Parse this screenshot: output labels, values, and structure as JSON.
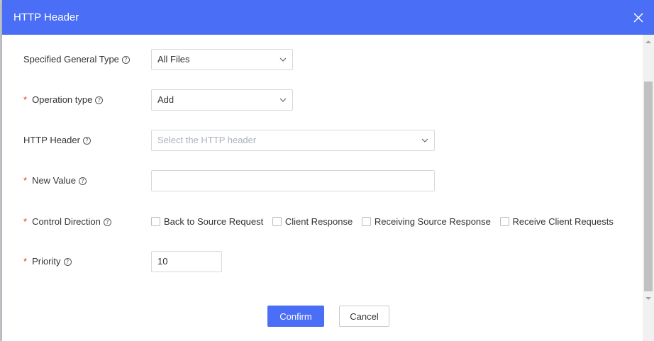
{
  "dialog": {
    "title": "HTTP Header",
    "close_icon": "close-icon"
  },
  "form": {
    "general_type": {
      "label": "Specified General Type",
      "required": false,
      "value": "All Files"
    },
    "operation_type": {
      "label": "Operation type",
      "required": true,
      "value": "Add"
    },
    "http_header": {
      "label": "HTTP Header",
      "required": false,
      "placeholder": "Select the HTTP header",
      "value": ""
    },
    "new_value": {
      "label": "New Value",
      "required": true,
      "value": ""
    },
    "control_direction": {
      "label": "Control Direction",
      "required": true,
      "options": [
        {
          "label": "Back to Source Request",
          "checked": false
        },
        {
          "label": "Client Response",
          "checked": false
        },
        {
          "label": "Receiving Source Response",
          "checked": false
        },
        {
          "label": "Receive Client Requests",
          "checked": false
        }
      ]
    },
    "priority": {
      "label": "Priority",
      "required": true,
      "value": "10"
    }
  },
  "required_mark": "*",
  "help_glyph": "?",
  "buttons": {
    "confirm": "Confirm",
    "cancel": "Cancel"
  },
  "colors": {
    "header": "#4a6ef5",
    "primary": "#4a6ef5",
    "required": "#e5372b"
  }
}
